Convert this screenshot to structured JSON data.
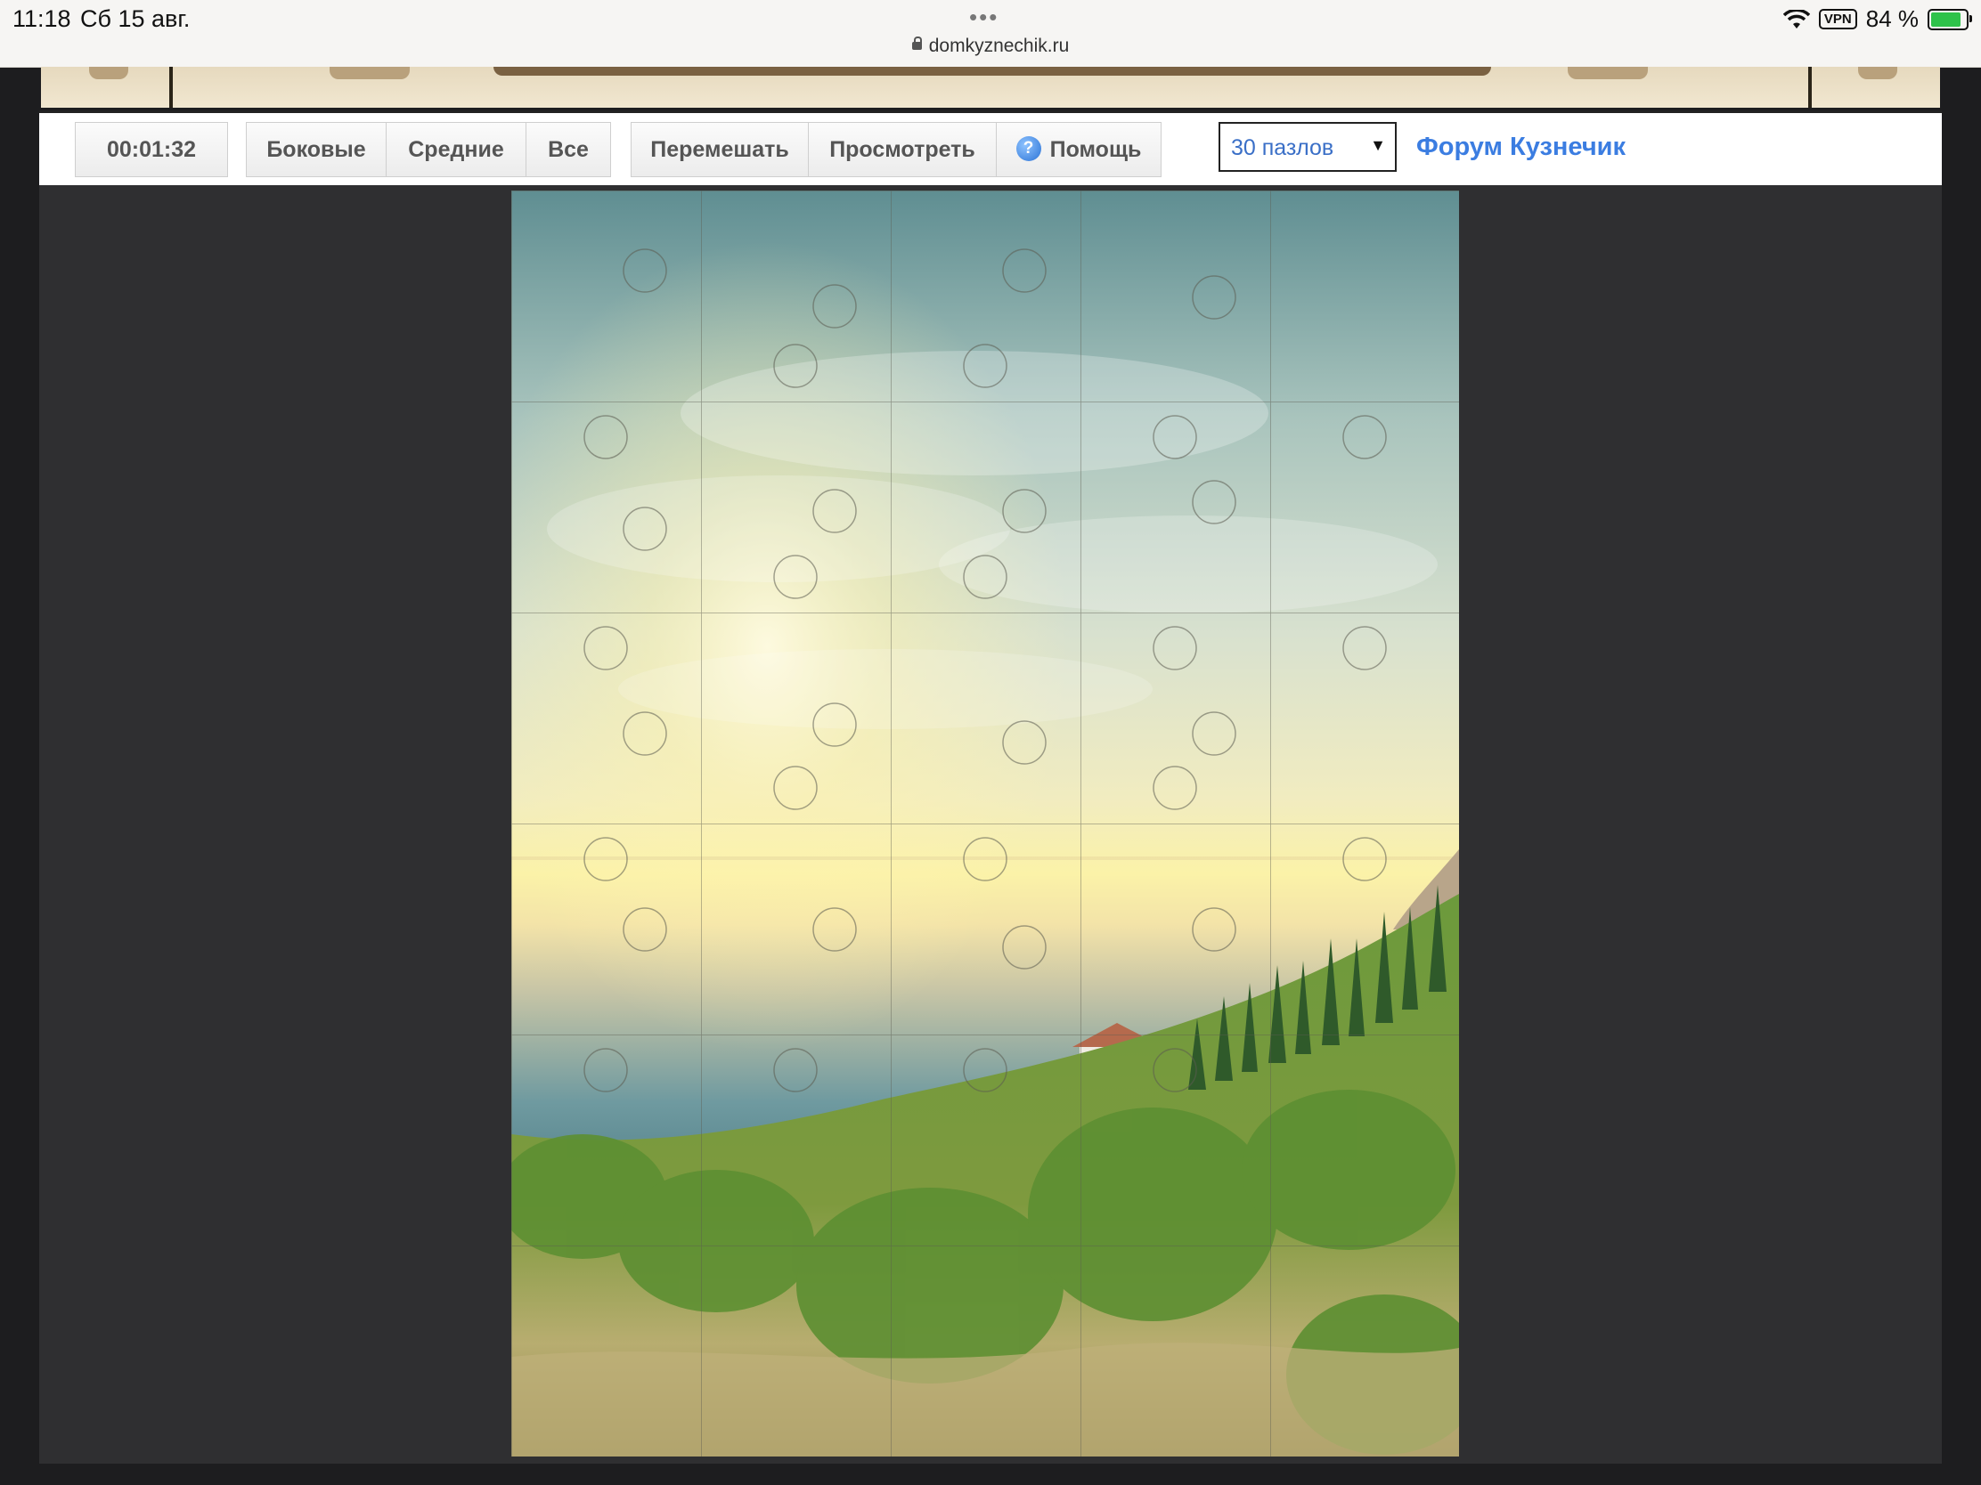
{
  "status_bar": {
    "time": "11:18",
    "date": "Сб 15 авг.",
    "dots": "•••",
    "url": "domkyznechik.ru",
    "vpn": "VPN",
    "battery": "84 %"
  },
  "toolbar": {
    "timer": "00:01:32",
    "filters": [
      "Боковые",
      "Средние",
      "Все"
    ],
    "actions": [
      "Перемешать",
      "Просмотреть",
      "Помощь"
    ],
    "pieces_select": "30 пазлов",
    "forum_link": "Форум Кузнечик"
  },
  "puzzle": {
    "columns": 5,
    "rows": 6,
    "pieces": 30
  },
  "colors": {
    "link": "#3b7de1",
    "panel_bg": "#2f2f31",
    "banner": "#eadfc6"
  }
}
